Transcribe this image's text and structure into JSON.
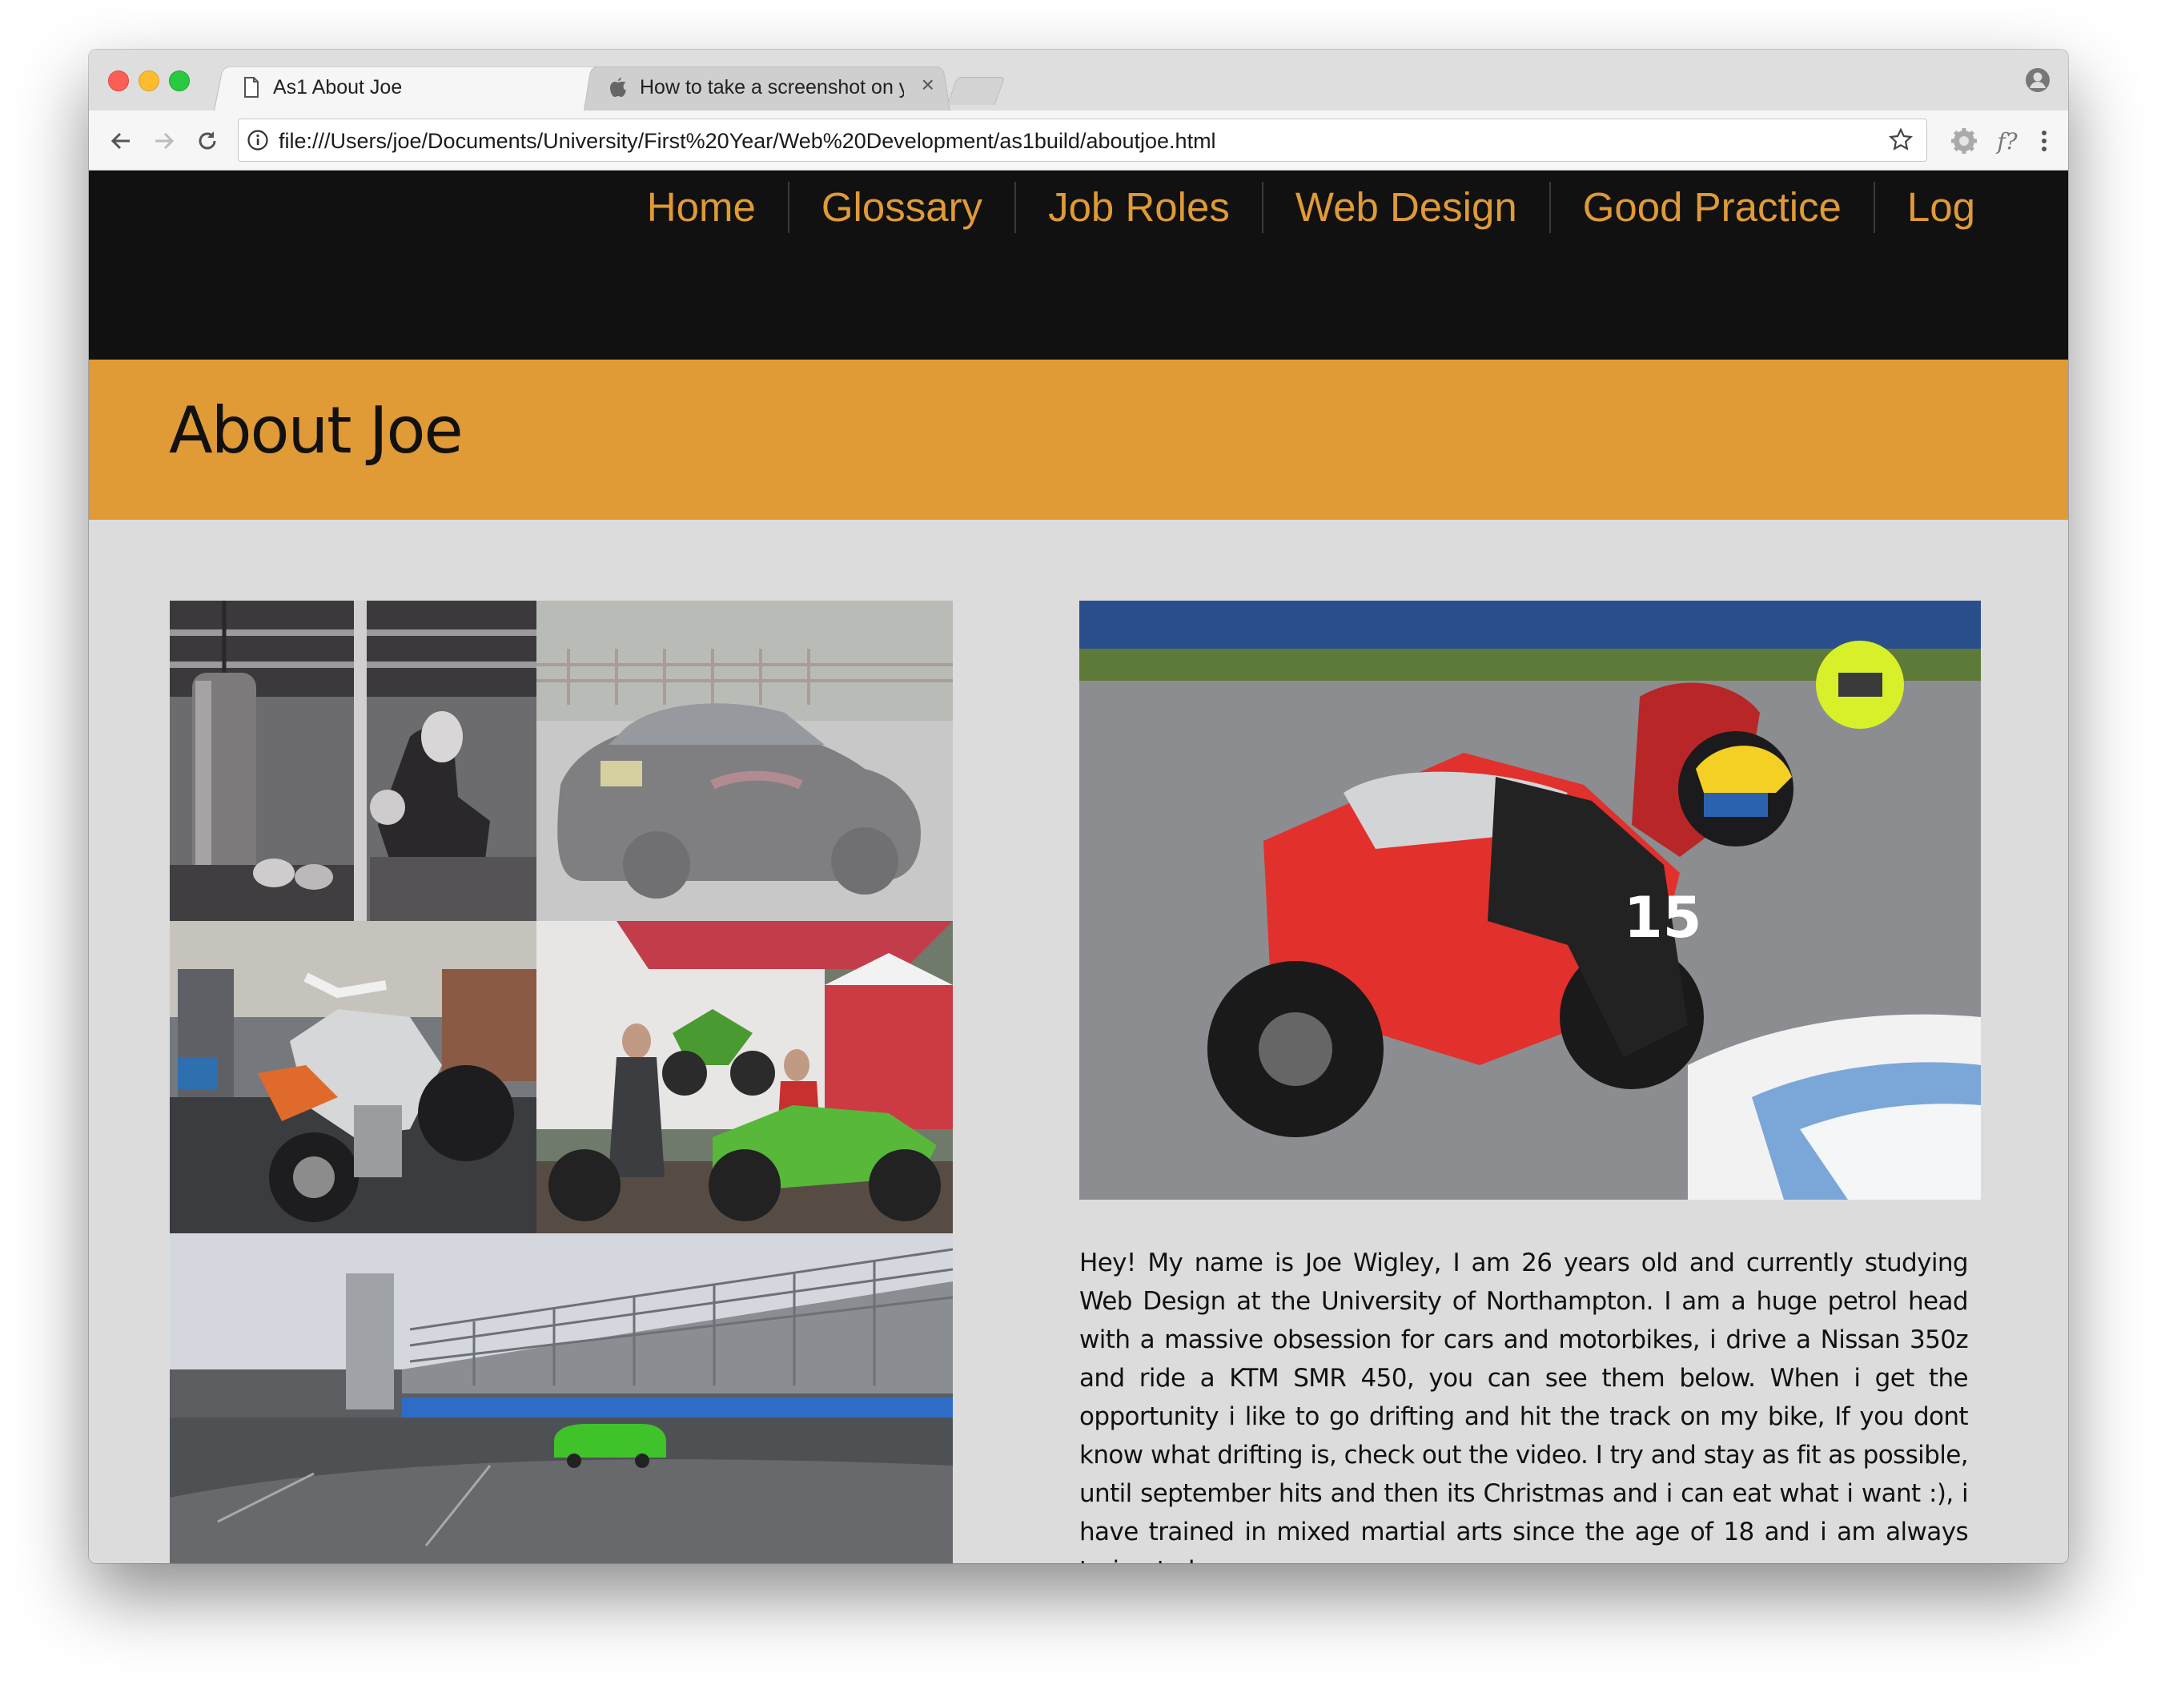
{
  "browser": {
    "tabs": [
      {
        "title": "As1 About Joe",
        "icon": "document-icon",
        "active": true
      },
      {
        "title": "How to take a screenshot on y",
        "icon": "apple-icon",
        "active": false
      }
    ],
    "close_glyph": "×",
    "url": "file:///Users/joe/Documents/University/First%20Year/Web%20Development/as1build/aboutjoe.html",
    "extension_fx": "f?"
  },
  "site": {
    "nav": [
      "Home",
      "Glossary",
      "Job Roles",
      "Web Design",
      "Good Practice",
      "Log"
    ],
    "page_title": "About Joe",
    "accent_color": "#e09a36",
    "header_color": "#111111",
    "bio": "Hey! My name is Joe Wigley, I am 26 years old and currently studying Web Design at the University of Northampton. I am a huge petrol head with a massive obsession for cars and motorbikes, i drive a Nissan 350z and ride a KTM SMR 450, you can see them below. When i get the opportunity i like to go drifting and hit the track on my bike, If you dont know what drifting is, check out the video. I try and stay as fit as possible, until september hits and then its Christmas and i can eat what i want :), i have trained in mixed martial arts since the age of 18 and i am always trying to be",
    "photos": {
      "boxing": "photo of boxing training with punch bags",
      "car": "photo of a black sports car",
      "motorbike_garage": "photo of a supermoto bike in a garage",
      "motocross": "photo of two riders with motocross bikes",
      "drift_track": "photo of a green car drifting at a race track",
      "track_bike": "photo of riders on red racing motorbike on a track"
    }
  }
}
